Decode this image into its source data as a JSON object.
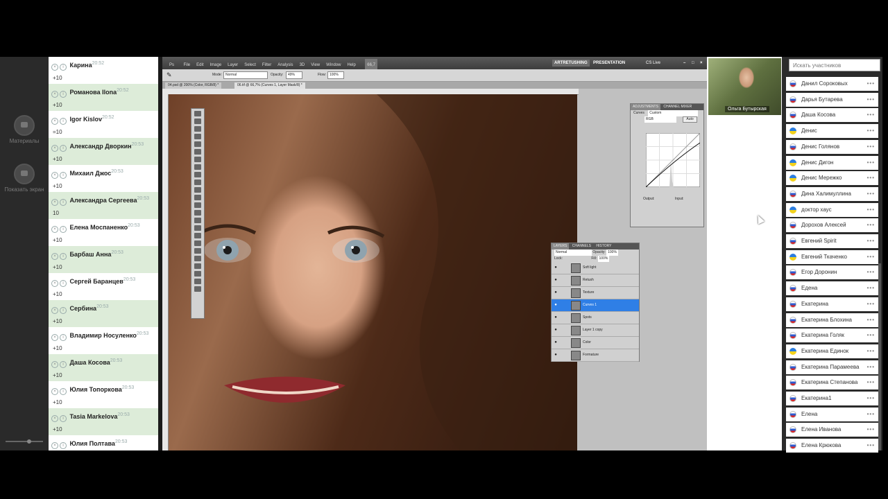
{
  "rail": {
    "materials_label": "Материалы",
    "share_label": "Показать экран"
  },
  "chat": {
    "messages": [
      {
        "name": "Карина",
        "time": "20:52",
        "text": "+10",
        "hl": false
      },
      {
        "name": "Романова Ilona",
        "time": "20:52",
        "text": "+10",
        "hl": true
      },
      {
        "name": "Igor Kislov",
        "time": "20:52",
        "text": "=10",
        "hl": false
      },
      {
        "name": "Александр Дворкин",
        "time": "20:53",
        "text": "+10",
        "hl": true
      },
      {
        "name": "Михаил Джос",
        "time": "20:53",
        "text": "+10",
        "hl": false
      },
      {
        "name": "Александра Сергеева",
        "time": "20:53",
        "text": "10",
        "hl": true
      },
      {
        "name": "Елена Моспаненко",
        "time": "20:53",
        "text": "+10",
        "hl": false
      },
      {
        "name": "Барбаш Анна",
        "time": "20:53",
        "text": "+10",
        "hl": true
      },
      {
        "name": "Сергей Баранцев",
        "time": "20:53",
        "text": "+10",
        "hl": false
      },
      {
        "name": "Сербина",
        "time": "20:53",
        "text": "+10",
        "hl": true
      },
      {
        "name": "Владимир Носуленко",
        "time": "20:53",
        "text": "+10",
        "hl": false
      },
      {
        "name": "Даша Косова",
        "time": "20:53",
        "text": "+10",
        "hl": true
      },
      {
        "name": "Юлия Топоркова",
        "time": "20:53",
        "text": "+10",
        "hl": false
      },
      {
        "name": "Tasia Markelova",
        "time": "20:53",
        "text": "+10",
        "hl": true
      },
      {
        "name": "Юлия Полтава",
        "time": "20:53",
        "text": "",
        "hl": false
      }
    ]
  },
  "photoshop": {
    "menus": [
      "File",
      "Edit",
      "Image",
      "Layer",
      "Select",
      "Filter",
      "Analysis",
      "3D",
      "View",
      "Window",
      "Help"
    ],
    "zoom": "66,7",
    "workspace_a": "ARTRETUSHING",
    "workspace_b": "PRESENTATION",
    "cs_live": "CS Live",
    "options": {
      "mode_label": "Mode:",
      "mode_value": "Normal",
      "opacity_label": "Opacity:",
      "opacity_value": "49%",
      "flow_label": "Flow:",
      "flow_value": "100%"
    },
    "tabs": [
      "04.psd @ 200% (Color, RGB/8) *",
      "06.tif @ 66,7% (Curves 1, Layer Mask/8) *"
    ],
    "adjustments": {
      "tabs": [
        "ADJUSTMENTS",
        "CHANNEL MIXER"
      ],
      "preset_label": "Curves",
      "preset_value": "Custom",
      "channel": "RGB",
      "auto": "Auto",
      "output_label": "Output:",
      "input_label": "Input:"
    },
    "layers": {
      "tabs": [
        "LAYERS",
        "CHANNELS",
        "HISTORY"
      ],
      "blend": "Normal",
      "opacity_label": "Opacity:",
      "opacity_value": "100%",
      "lock_label": "Lock:",
      "fill_label": "Fill:",
      "fill_value": "100%",
      "rows": [
        {
          "name": "Soft light",
          "sel": false
        },
        {
          "name": "Retush",
          "sel": false
        },
        {
          "name": "Texture",
          "sel": false
        },
        {
          "name": "Curves 1",
          "sel": true
        },
        {
          "name": "Spots",
          "sel": false
        },
        {
          "name": "Layer 1 copy",
          "sel": false
        },
        {
          "name": "Color",
          "sel": false
        },
        {
          "name": "Formature",
          "sel": false
        }
      ]
    }
  },
  "video": {
    "label": "Ольга Бутырская"
  },
  "participants": {
    "search_placeholder": "Искать участников",
    "items": [
      {
        "name": "Данил Сороковых",
        "flag": "ru"
      },
      {
        "name": "Дарья Бутарева",
        "flag": "ru"
      },
      {
        "name": "Даша Косова",
        "flag": "ru"
      },
      {
        "name": "Денис",
        "flag": "ua"
      },
      {
        "name": "Денис Голянов",
        "flag": "ru"
      },
      {
        "name": "Денис Дигон",
        "flag": "ua"
      },
      {
        "name": "Денис Мережко",
        "flag": "ua"
      },
      {
        "name": "Дина Халимуллина",
        "flag": "ru"
      },
      {
        "name": "доктор хаус",
        "flag": "ua"
      },
      {
        "name": "Дорохов Алексей",
        "flag": "ru"
      },
      {
        "name": "Евгений Spirit",
        "flag": "ru"
      },
      {
        "name": "Евгений Ткаченко",
        "flag": "ua"
      },
      {
        "name": "Егор Доронин",
        "flag": "ru"
      },
      {
        "name": "Едена",
        "flag": "ru"
      },
      {
        "name": "Екатерина",
        "flag": "ru"
      },
      {
        "name": "Екатерина Блохина",
        "flag": "ru"
      },
      {
        "name": "Екатерина Голяк",
        "flag": "ru"
      },
      {
        "name": "Екатерина Единок",
        "flag": "ua"
      },
      {
        "name": "Екатерина Парамеева",
        "flag": "ru"
      },
      {
        "name": "Екатерина Степанова",
        "flag": "ru"
      },
      {
        "name": "Екатерина1",
        "flag": "ru"
      },
      {
        "name": "Елена",
        "flag": "ru"
      },
      {
        "name": "Елена Иванова",
        "flag": "ru"
      },
      {
        "name": "Елена Крюкова",
        "flag": "ru"
      }
    ]
  }
}
